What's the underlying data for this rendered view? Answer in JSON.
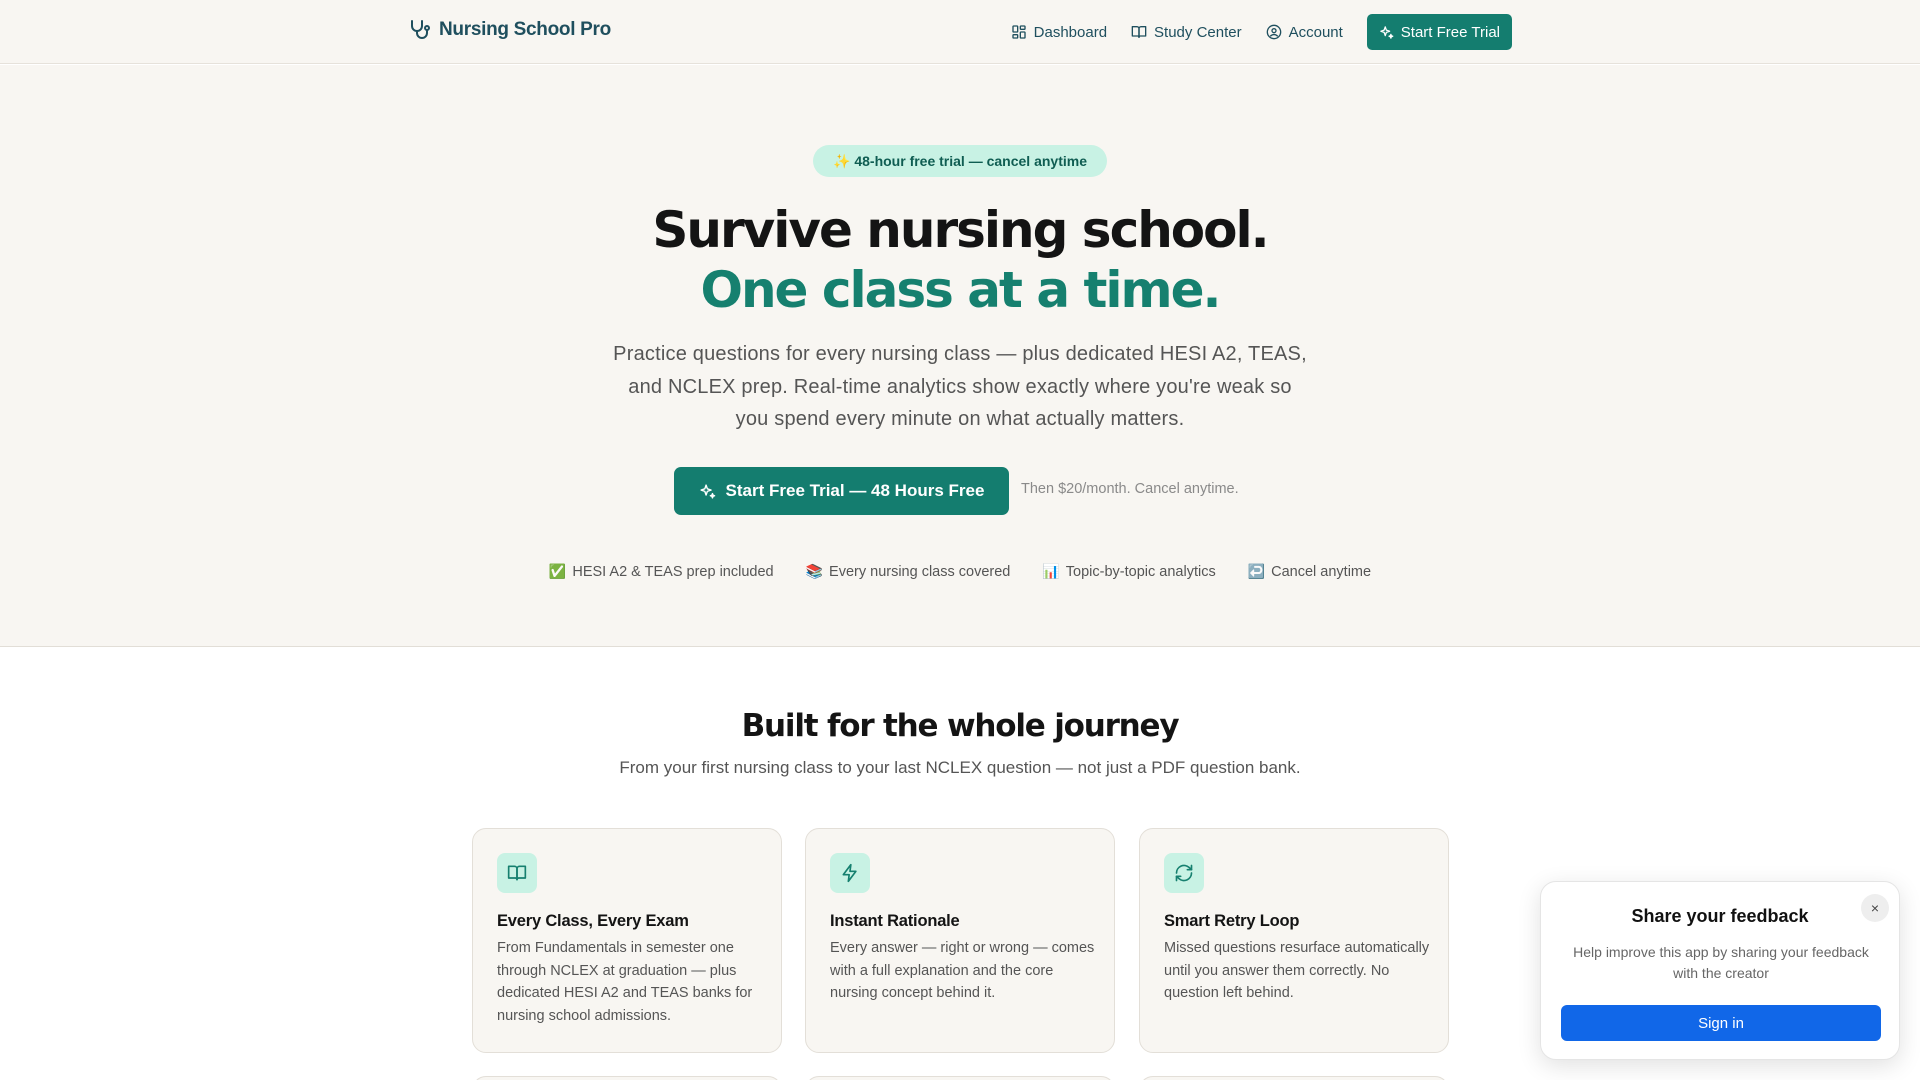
{
  "header": {
    "brand": "Nursing School Pro",
    "nav": [
      {
        "label": "Dashboard",
        "icon": "dashboard-icon"
      },
      {
        "label": "Study Center",
        "icon": "book-open-icon"
      },
      {
        "label": "Account",
        "icon": "user-circle-icon"
      }
    ],
    "cta": "Start Free Trial"
  },
  "hero": {
    "badge": "✨ 48-hour free trial — cancel anytime",
    "title_line1": "Survive nursing school.",
    "title_line2": "One class at a time.",
    "lead": "Practice questions for every nursing class — plus dedicated HESI A2, TEAS, and NCLEX prep. Real-time analytics show exactly where you're weak so you spend every minute on what actually matters.",
    "cta": "Start Free Trial — 48 Hours Free",
    "note": "Then $20/month. Cancel anytime.",
    "perks": [
      {
        "emoji": "✅",
        "text": "HESI A2 & TEAS prep included"
      },
      {
        "emoji": "📚",
        "text": "Every nursing class covered"
      },
      {
        "emoji": "📊",
        "text": "Topic-by-topic analytics"
      },
      {
        "emoji": "↩️",
        "text": "Cancel anytime"
      }
    ]
  },
  "features": {
    "title": "Built for the whole journey",
    "subtitle": "From your first nursing class to your last NCLEX question — not just a PDF question bank.",
    "cards": [
      {
        "icon": "book-open-icon",
        "title": "Every Class, Every Exam",
        "body": "From Fundamentals in semester one through NCLEX at graduation — plus dedicated HESI A2 and TEAS banks for nursing school admissions."
      },
      {
        "icon": "lightning-icon",
        "title": "Instant Rationale",
        "body": "Every answer — right or wrong — comes with a full explanation and the core nursing concept behind it."
      },
      {
        "icon": "refresh-icon",
        "title": "Smart Retry Loop",
        "body": "Missed questions resurface automatically until you answer them correctly. No question left behind."
      }
    ]
  },
  "feedback": {
    "title": "Share your feedback",
    "text": "Help improve this app by sharing your feedback with the creator",
    "button": "Sign in",
    "close": "×"
  },
  "colors": {
    "brand": "#147d6f",
    "accent_light": "#c8f2e4",
    "nav_text": "#1f4f5e",
    "feedback_button": "#1167e8"
  }
}
